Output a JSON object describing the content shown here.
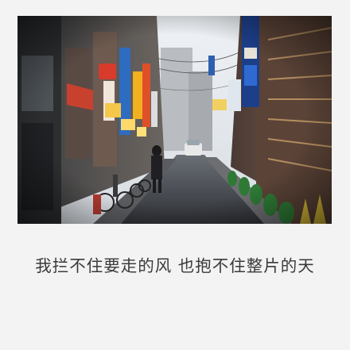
{
  "caption": "我拦不住要走的风 也抱不住整片的天"
}
